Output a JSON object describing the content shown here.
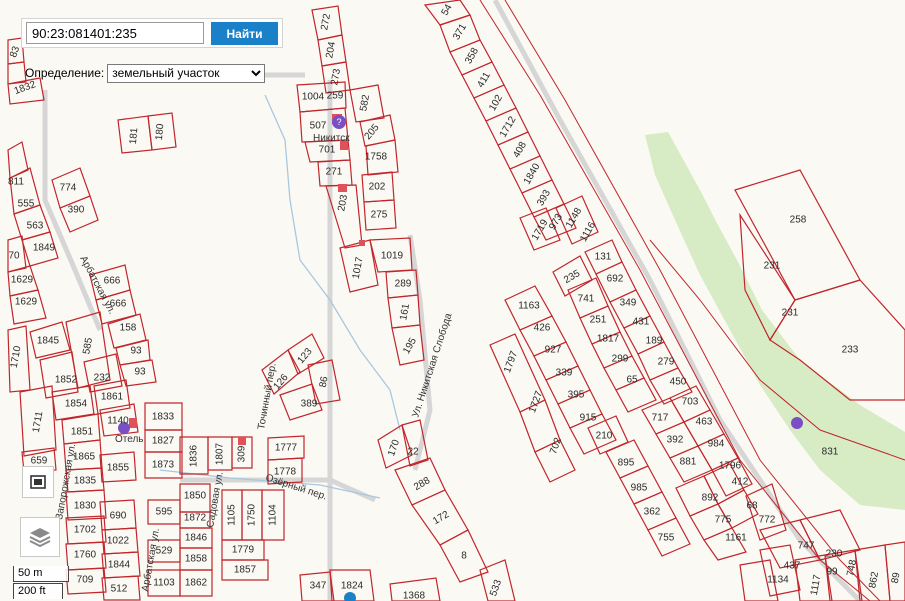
{
  "search": {
    "value": "90:23:081401:235",
    "button_label": "Найти"
  },
  "definition": {
    "label": "Определение:",
    "selected": "земельный участок"
  },
  "scale": {
    "metric": "50 m",
    "imperial": "200 ft"
  },
  "streets": {
    "arbatskaya": "Арбатская ул.",
    "nikitskaya": "Ул. Никитская Слобода",
    "ozerny": "Озёрный пер.",
    "tochinny": "Точинный пер.",
    "zaporozhskaya": "Запорожская ул.",
    "sadovaya": "Садовая ул.",
    "arbatskaya2": "Арбатская ул."
  },
  "pois": {
    "nikitsky": "Никитск",
    "hotel": "Отель"
  },
  "parcels": {
    "p272": "272",
    "p204": "204",
    "p273": "273",
    "p54": "54",
    "p371": "371",
    "p358": "358",
    "p411": "411",
    "p102": "102",
    "p1712": "1712",
    "p408": "408",
    "p1840": "1840",
    "p393": "393",
    "p973": "973",
    "p1148": "1148",
    "p1116": "1116",
    "p1719": "1719",
    "p1004": "1004",
    "p259": "259",
    "p582": "582",
    "p507": "507",
    "p205": "205",
    "p701": "701",
    "p1758": "1758",
    "p271": "271",
    "p202": "202",
    "p203": "203",
    "p275": "275",
    "p181": "181",
    "p180": "180",
    "p774": "774",
    "p390": "390",
    "p811": "811",
    "p555": "555",
    "p563": "563",
    "p1849": "1849",
    "p1832": "1832",
    "p83": "83",
    "p70": "70",
    "p1629a": "1629",
    "p1629b": "1629",
    "p1710": "1710",
    "p666a": "666",
    "p666b": "666",
    "p158": "158",
    "p93a": "93",
    "p93b": "93",
    "p1845": "1845",
    "p585": "585",
    "p1852": "1852",
    "p232": "232",
    "p1854": "1854",
    "p1861": "1861",
    "p1711": "1711",
    "p1851": "1851",
    "p1140": "1140",
    "p1865": "1865",
    "p1855": "1855",
    "p1835": "1835",
    "p1830": "1830",
    "p659": "659",
    "p690": "690",
    "p1702": "1702",
    "p1022": "1022",
    "p1760": "1760",
    "p1844": "1844",
    "p709": "709",
    "p512": "512",
    "p1833": "1833",
    "p1827": "1827",
    "p1873": "1873",
    "p1836": "1836",
    "p1807": "1807",
    "p309": "309",
    "p1777": "1777",
    "p1778": "1778",
    "p1850": "1850",
    "p595": "595",
    "p1872": "1872",
    "p1846": "1846",
    "p529": "529",
    "p1858": "1858",
    "p1103": "1103",
    "p1862": "1862",
    "p1105": "1105",
    "p1750": "1750",
    "p1104": "1104",
    "p1779": "1779",
    "p1857": "1857",
    "p126": "126",
    "p123": "123",
    "p86": "86",
    "p389": "389",
    "p1017": "1017",
    "p1019": "1019",
    "p289": "289",
    "p161": "161",
    "p195": "195",
    "p170": "170",
    "p22": "22",
    "p288": "288",
    "p172": "172",
    "p8": "8",
    "p347": "347",
    "p1824": "1824",
    "p1368": "1368",
    "p533": "533",
    "p235": "235",
    "p131": "131",
    "p692": "692",
    "p741": "741",
    "p349": "349",
    "p251": "251",
    "p431": "431",
    "p1817": "1817",
    "p189": "189",
    "p299": "299",
    "p279": "279",
    "p65": "65",
    "p450": "450",
    "p1163": "1163",
    "p426": "426",
    "p927": "927",
    "p339": "339",
    "p395": "395",
    "p915": "915",
    "p210": "210",
    "p1797": "1797",
    "p1727": "1727",
    "p702": "702",
    "p717": "717",
    "p703": "703",
    "p392": "392",
    "p463": "463",
    "p881": "881",
    "p984": "984",
    "p1796": "1796",
    "p895": "895",
    "p985": "985",
    "p362": "362",
    "p755": "755",
    "p892": "892",
    "p412": "412",
    "p775": "775",
    "p68": "68",
    "p1161": "1161",
    "p772": "772",
    "p258": "258",
    "p231a": "231",
    "p231b": "231",
    "p233": "233",
    "p831": "831",
    "p747": "747",
    "p230": "230",
    "p437": "437",
    "p1134": "1134",
    "p1117": "1117",
    "p99": "99",
    "p748": "748",
    "p862": "862",
    "p89": "89"
  }
}
